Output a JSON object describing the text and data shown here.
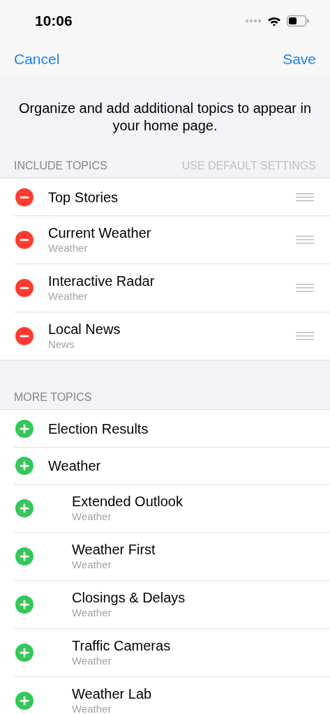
{
  "status_bar": {
    "time": "10:06"
  },
  "nav": {
    "cancel": "Cancel",
    "save": "Save"
  },
  "intro": "Organize and add additional topics to appear in your home page.",
  "sections": [
    {
      "kind": "remove",
      "header": "INCLUDE TOPICS",
      "action": "USE DEFAULT SETTINGS",
      "items": [
        {
          "title": "Top Stories"
        },
        {
          "title": "Current Weather",
          "subtitle": "Weather"
        },
        {
          "title": "Interactive Radar",
          "subtitle": "Weather"
        },
        {
          "title": "Local News",
          "subtitle": "News"
        }
      ]
    },
    {
      "kind": "add",
      "header": "MORE TOPICS",
      "items": [
        {
          "title": "Election Results"
        },
        {
          "title": "Weather",
          "children": [
            {
              "title": "Extended Outlook",
              "subtitle": "Weather"
            },
            {
              "title": "Weather First",
              "subtitle": "Weather"
            },
            {
              "title": "Closings & Delays",
              "subtitle": "Weather"
            },
            {
              "title": "Traffic Cameras",
              "subtitle": "Weather"
            },
            {
              "title": "Weather Lab",
              "subtitle": "Weather"
            }
          ]
        }
      ]
    }
  ]
}
